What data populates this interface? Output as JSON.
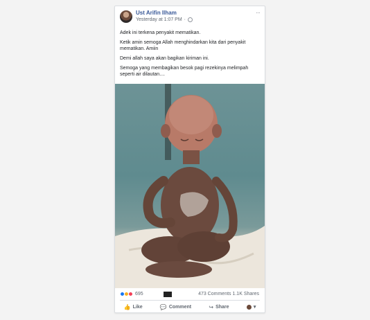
{
  "post": {
    "author": "Ust Arifin Ilham",
    "timestamp": "Yesterday at 1:07 PM",
    "separator": "·",
    "more": "···",
    "paragraphs": [
      "Adek ini terkena penyakit mematikan.",
      "Ketik amin semoga Allah menghindarkan kita dari penyakit mematikan. Amiin",
      "Demi allah saya akan bagikan kiriman ini.",
      "Semoga yang membagikan besok pagi rezekinya melimpah seperti air dilautan...."
    ]
  },
  "stats": {
    "reactions": "695",
    "comments_shares": "473 Comments 1.1K Shares"
  },
  "actions": {
    "like": "Like",
    "comment": "Comment",
    "share": "Share"
  },
  "icons": {
    "like": "👍",
    "comment": "💬",
    "share": "↪",
    "dropdown": "▾"
  },
  "colors": {
    "author": "#385898",
    "like_reaction": "#1877f2",
    "love_reaction": "#f33e58",
    "wow_reaction": "#f7b125"
  }
}
